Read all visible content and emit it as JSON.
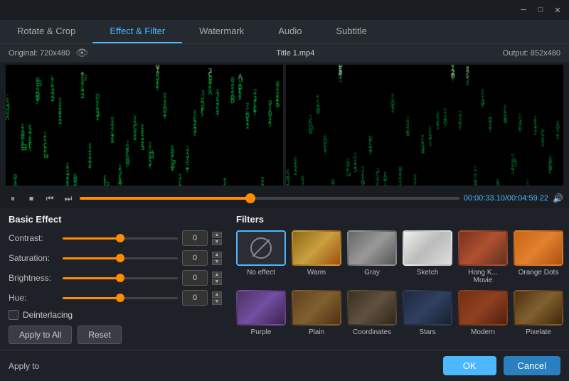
{
  "titlebar": {
    "minimize_label": "─",
    "maximize_label": "□",
    "close_label": "✕"
  },
  "tabs": [
    {
      "id": "rotate-crop",
      "label": "Rotate & Crop",
      "active": false
    },
    {
      "id": "effect-filter",
      "label": "Effect & Filter",
      "active": true
    },
    {
      "id": "watermark",
      "label": "Watermark",
      "active": false
    },
    {
      "id": "audio",
      "label": "Audio",
      "active": false
    },
    {
      "id": "subtitle",
      "label": "Subtitle",
      "active": false
    }
  ],
  "video": {
    "original_label": "Original: 720x480",
    "output_label": "Output: 852x480",
    "title": "Title 1.mp4",
    "time_current": "00:00:33.10",
    "time_total": "00:04:59.22"
  },
  "controls": {
    "pause": "⏸",
    "stop": "⏹",
    "prev": "⏮",
    "next": "⏭"
  },
  "basic_effect": {
    "title": "Basic Effect",
    "contrast_label": "Contrast:",
    "contrast_value": "0",
    "saturation_label": "Saturation:",
    "saturation_value": "0",
    "brightness_label": "Brightness:",
    "brightness_value": "0",
    "hue_label": "Hue:",
    "hue_value": "0",
    "deinterlacing_label": "Deinterlacing",
    "apply_all_label": "Apply to All",
    "reset_label": "Reset"
  },
  "filters": {
    "title": "Filters",
    "items": [
      {
        "id": "no-effect",
        "label": "No effect",
        "active": true
      },
      {
        "id": "warm",
        "label": "Warm",
        "active": false
      },
      {
        "id": "gray",
        "label": "Gray",
        "active": false
      },
      {
        "id": "sketch",
        "label": "Sketch",
        "active": false
      },
      {
        "id": "hongk-movie",
        "label": "Hong K... Movie",
        "active": false
      },
      {
        "id": "orange-dots",
        "label": "Orange Dots",
        "active": false
      },
      {
        "id": "purple",
        "label": "Purple",
        "active": false
      },
      {
        "id": "plain",
        "label": "Plain",
        "active": false
      },
      {
        "id": "coordinates",
        "label": "Coordinates",
        "active": false
      },
      {
        "id": "stars",
        "label": "Stars",
        "active": false
      },
      {
        "id": "modern",
        "label": "Modern",
        "active": false
      },
      {
        "id": "pixelate",
        "label": "Pixelate",
        "active": false
      }
    ]
  },
  "bottom": {
    "apply_to_label": "Apply to",
    "ok_label": "OK",
    "cancel_label": "Cancel"
  }
}
